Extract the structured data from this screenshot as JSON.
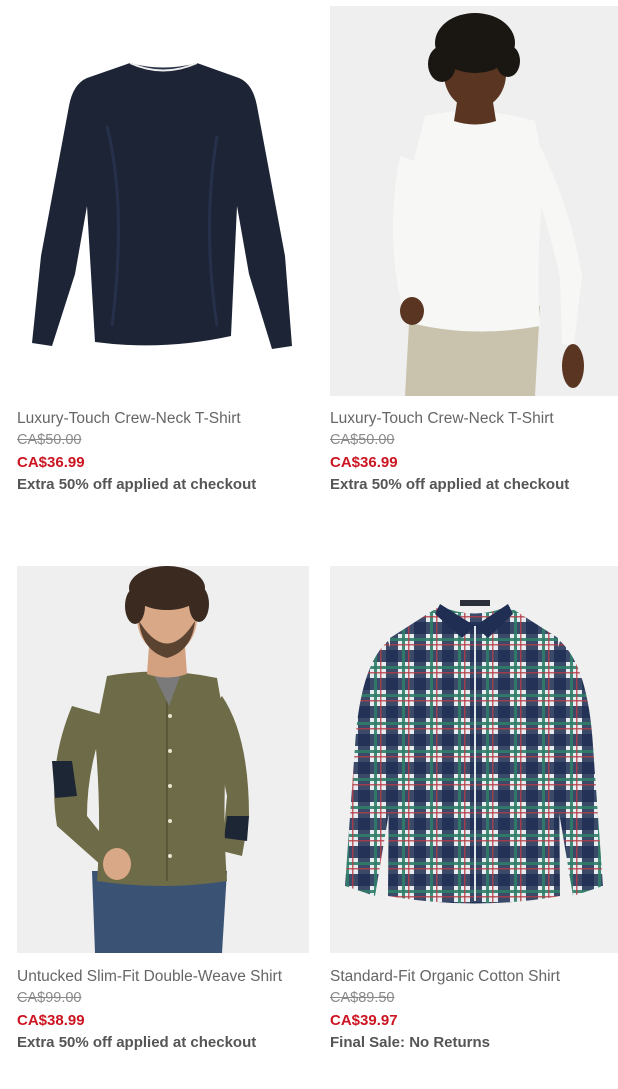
{
  "products": [
    {
      "name": "Luxury-Touch Crew-Neck T-Shirt",
      "original_price": "CA$50.00",
      "sale_price": "CA$36.99",
      "promo": "Extra 50% off applied at checkout",
      "image": "navy-long-sleeve-tee",
      "image_color": "#1c2436"
    },
    {
      "name": "Luxury-Touch Crew-Neck T-Shirt",
      "original_price": "CA$50.00",
      "sale_price": "CA$36.99",
      "promo": "Extra 50% off applied at checkout",
      "image": "model-white-long-sleeve-tee",
      "image_color": "#f4f4f2"
    },
    {
      "name": "Untucked Slim-Fit Double-Weave Shirt",
      "original_price": "CA$99.00",
      "sale_price": "CA$38.99",
      "promo": "Extra 50% off applied at checkout",
      "image": "model-olive-button-shirt",
      "image_color": "#6e6b48"
    },
    {
      "name": "Standard-Fit Organic Cotton Shirt",
      "original_price": "CA$89.50",
      "sale_price": "CA$39.97",
      "promo": "Final Sale: No Returns",
      "image": "plaid-button-shirt",
      "image_color": "#2b3b5c"
    }
  ],
  "colors": {
    "sale_price": "#cc1522",
    "name_text": "#666666",
    "original_price": "#8a8a8a",
    "promo_text": "#555555"
  }
}
